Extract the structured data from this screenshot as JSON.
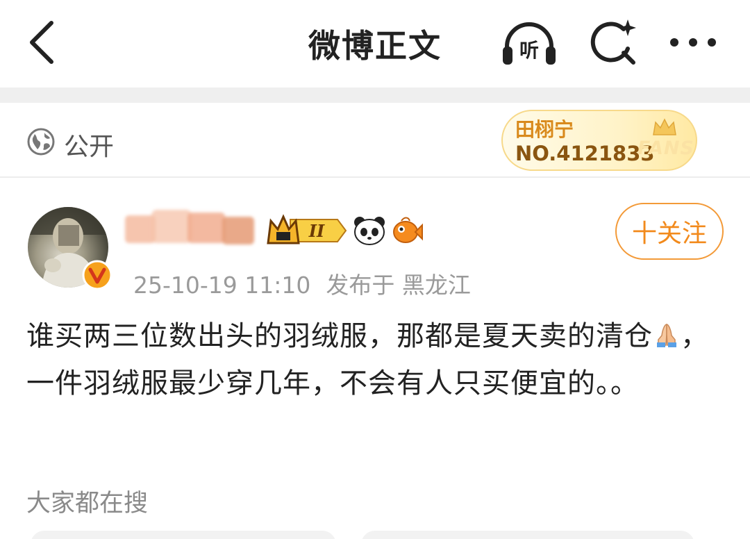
{
  "nav": {
    "title": "微博正文",
    "listen_label": "听"
  },
  "visibility": {
    "label": "公开"
  },
  "fans_card": {
    "name": "田栩宁",
    "number": "NO.4121833",
    "badge_word": "FANS"
  },
  "post": {
    "vip_level": "II",
    "follow_label": "十关注",
    "timestamp": "25-10-19 11:10",
    "location": "发布于 黑龙江",
    "text_part1": "谁买两三位数出头的羽绒服，那都是夏天卖的清仓",
    "text_part2": "，一件羽绒服最少穿几年，不会有人只买便宜的。。"
  },
  "section": {
    "search_hint": "大家都在搜"
  },
  "colors": {
    "accent": "#f28a1c",
    "verify": "#f6a11c",
    "muted": "#9a9a9a"
  },
  "icons": [
    "back-arrow-icon",
    "headphones-icon",
    "search-sparkle-icon",
    "more-icon",
    "globe-icon",
    "crown-icon",
    "panda-icon",
    "fish-icon",
    "verify-icon",
    "praying-hands-icon"
  ]
}
